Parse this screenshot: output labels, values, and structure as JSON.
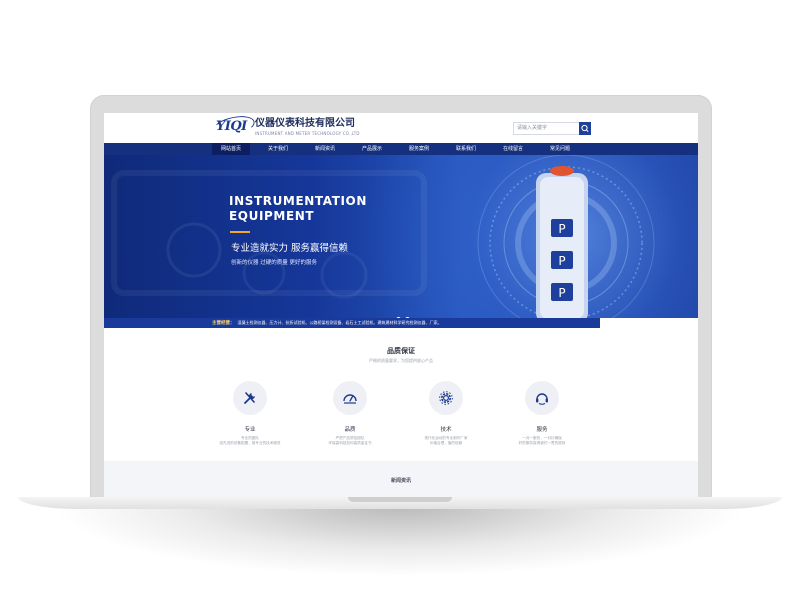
{
  "header": {
    "company_name": "仪器仪表科技有限公司",
    "company_en": "INSTRUMENT AND METER TECHNOLOGY CO.,LTD",
    "logo_text": "YIQI",
    "search_placeholder": "请输入关键字"
  },
  "nav": {
    "items": [
      {
        "label": "网站首页",
        "active": true
      },
      {
        "label": "关于我们"
      },
      {
        "label": "新闻资讯"
      },
      {
        "label": "产品展示"
      },
      {
        "label": "服务案例"
      },
      {
        "label": "联系我们"
      },
      {
        "label": "在线留言"
      },
      {
        "label": "常见问题"
      }
    ]
  },
  "banner": {
    "title_line1": "INSTRUMENTATION",
    "title_line2": "EQUIPMENT",
    "slogan": "专业造就实力  服务赢得信赖",
    "subtitle": "创新的仪器  过硬的质量  更好的服务",
    "slides": 2,
    "active_slide": 2
  },
  "business": {
    "label": "主营经营：",
    "text": "混凝土检测仪器、压力计、抗折试验机、公路桥梁检测设备、岩石土工试验机、建筑建材科学研究检测仪器、厂家。"
  },
  "quality": {
    "title": "品质保证",
    "subtitle": "严格的质量要求，为您提供放心产品",
    "features": [
      {
        "icon": "tools-icon",
        "name": "专业",
        "desc1": "专业的团队",
        "desc2": "给先进的设备配置，雄专业的技术服务"
      },
      {
        "icon": "gauge-icon",
        "name": "品质",
        "desc1": "严把产品质检团队",
        "desc2": "环保高科技如何高质量证书"
      },
      {
        "icon": "gear-icon",
        "name": "技术",
        "desc1": "现代化运动的专业制作厂家",
        "desc2": "价格合理，值的信赖"
      },
      {
        "icon": "headset-icon",
        "name": "服务",
        "desc1": "一对一服务，一对针确保",
        "desc2": "好的服务赢得我们一贯的原则"
      }
    ]
  },
  "next_section": {
    "title": "新闻资讯"
  },
  "colors": {
    "primary": "#15307f",
    "nav_active": "#0d1e63",
    "accent": "#f5a623"
  }
}
